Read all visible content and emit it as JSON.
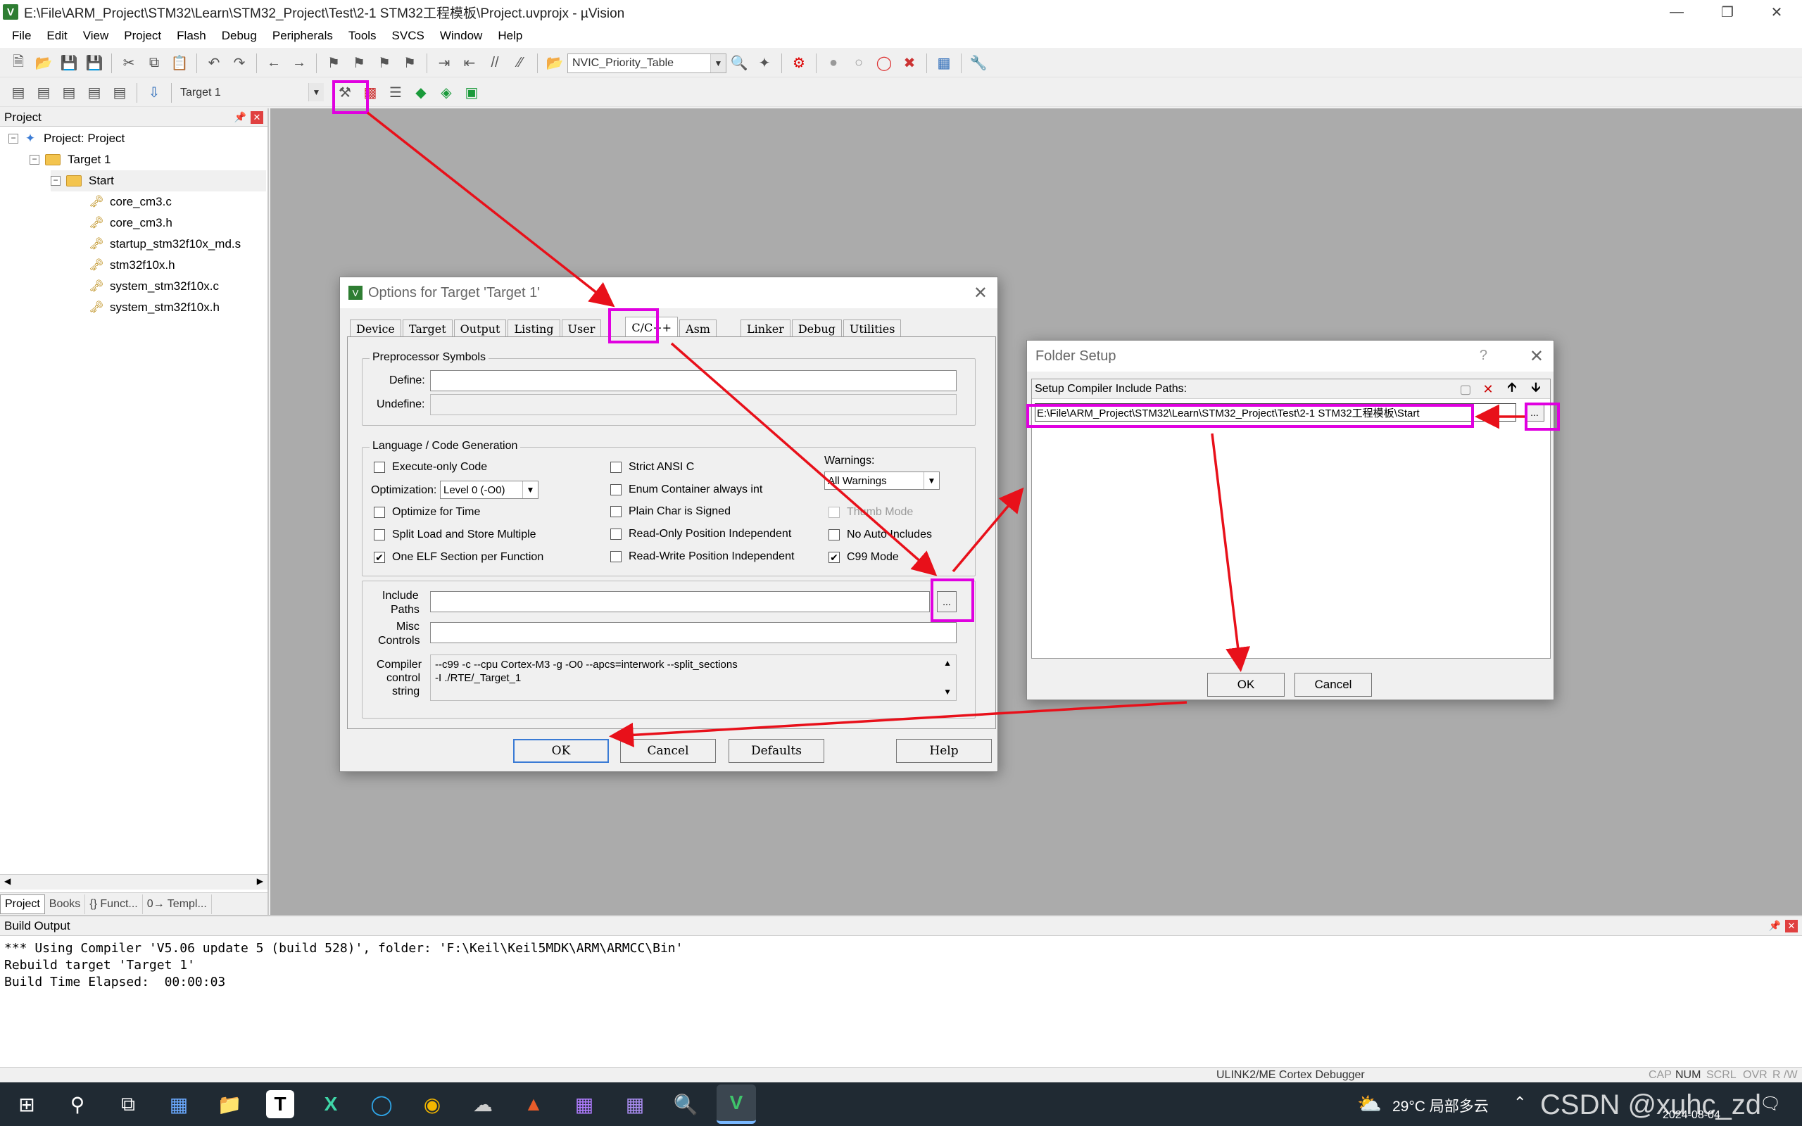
{
  "window": {
    "title": "E:\\File\\ARM_Project\\STM32\\Learn\\STM32_Project\\Test\\2-1 STM32工程模板\\Project.uvprojx - µVision",
    "app_icon": "V"
  },
  "menu": [
    "File",
    "Edit",
    "View",
    "Project",
    "Flash",
    "Debug",
    "Peripherals",
    "Tools",
    "SVCS",
    "Window",
    "Help"
  ],
  "toolbar": {
    "find_combo": "NVIC_Priority_Table",
    "target_combo": "Target 1"
  },
  "project_panel": {
    "header": "Project",
    "root": "Project: Project",
    "target": "Target 1",
    "group": "Start",
    "files": [
      "core_cm3.c",
      "core_cm3.h",
      "startup_stm32f10x_md.s",
      "stm32f10x.h",
      "system_stm32f10x.c",
      "system_stm32f10x.h"
    ],
    "tabs": [
      "Project",
      "Books",
      "{} Funct...",
      "0→ Templ..."
    ]
  },
  "options_dialog": {
    "title": "Options for Target 'Target 1'",
    "tabs": [
      "Device",
      "Target",
      "Output",
      "Listing",
      "User",
      "C/C++",
      "Asm",
      "Linker",
      "Debug",
      "Utilities"
    ],
    "preprocessor_group": "Preprocessor Symbols",
    "define_label": "Define:",
    "undefine_label": "Undefine:",
    "language_group": "Language / Code Generation",
    "checkboxes_col1": [
      {
        "label": "Execute-only Code",
        "checked": false
      },
      {
        "label": "Optimize for Time",
        "checked": false
      },
      {
        "label": "Split Load and Store Multiple",
        "checked": false
      },
      {
        "label": "One ELF Section per Function",
        "checked": true
      }
    ],
    "optimization_label": "Optimization:",
    "optimization_value": "Level 0 (-O0)",
    "checkboxes_col2": [
      {
        "label": "Strict ANSI C",
        "checked": false
      },
      {
        "label": "Enum Container always int",
        "checked": false
      },
      {
        "label": "Plain Char is Signed",
        "checked": false
      },
      {
        "label": "Read-Only Position Independent",
        "checked": false
      },
      {
        "label": "Read-Write Position Independent",
        "checked": false
      }
    ],
    "warnings_label": "Warnings:",
    "warnings_value": "All Warnings",
    "checkboxes_col3": [
      {
        "label": "Thumb Mode",
        "checked": false,
        "disabled": true
      },
      {
        "label": "No Auto Includes",
        "checked": false
      },
      {
        "label": "C99 Mode",
        "checked": true
      }
    ],
    "include_label_1": "Include",
    "include_label_2": "Paths",
    "misc_label_1": "Misc",
    "misc_label_2": "Controls",
    "compiler_label_1": "Compiler",
    "compiler_label_2": "control",
    "compiler_label_3": "string",
    "compiler_line1": "--c99 -c --cpu Cortex-M3 -g -O0 --apcs=interwork --split_sections",
    "compiler_line2": "-I ./RTE/_Target_1",
    "browse": "...",
    "btn_ok": "OK",
    "btn_cancel": "Cancel",
    "btn_defaults": "Defaults",
    "btn_help": "Help"
  },
  "folder_dialog": {
    "title": "Folder Setup",
    "help_glyph": "?",
    "label": "Setup Compiler Include Paths:",
    "path": "E:\\File\\ARM_Project\\STM32\\Learn\\STM32_Project\\Test\\2-1 STM32工程模板\\Start",
    "browse": "...",
    "btn_ok": "OK",
    "btn_cancel": "Cancel"
  },
  "build_output": {
    "header": "Build Output",
    "lines": [
      "*** Using Compiler 'V5.06 update 5 (build 528)', folder: 'F:\\Keil\\Keil5MDK\\ARM\\ARMCC\\Bin'",
      "Rebuild target 'Target 1'",
      "Build Time Elapsed:  00:00:03"
    ]
  },
  "statusbar": {
    "debugger": "ULINK2/ME Cortex Debugger",
    "indicators": [
      "CAP",
      "NUM",
      "SCRL",
      "OVR",
      "R /W"
    ]
  },
  "taskbar": {
    "weather": "29°C  局部多云",
    "date": "2024-08-04",
    "watermark": "CSDN @xuhc_zd"
  },
  "colors": {
    "highlight": "#e000e0",
    "arrow": "#e8101a",
    "workspace": "#ababab"
  }
}
